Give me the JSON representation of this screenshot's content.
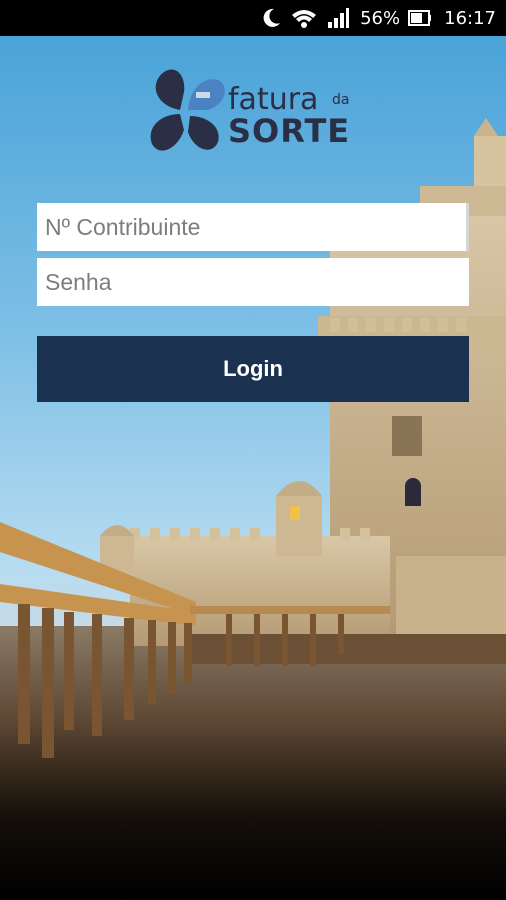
{
  "status_bar": {
    "battery_percent": "56%",
    "time": "16:17",
    "icons": [
      "moon-icon",
      "wifi-icon",
      "signal-icon",
      "battery-icon"
    ]
  },
  "logo": {
    "word_top": "fatura",
    "word_small": "da",
    "word_bottom": "SORTE"
  },
  "form": {
    "contribuinte_placeholder": "Nº Contribuinte",
    "senha_placeholder": "Senha",
    "login_label": "Login"
  },
  "colors": {
    "button": "#1a3150",
    "logo": "#2a2f45",
    "sky": "#4aa3d8"
  }
}
